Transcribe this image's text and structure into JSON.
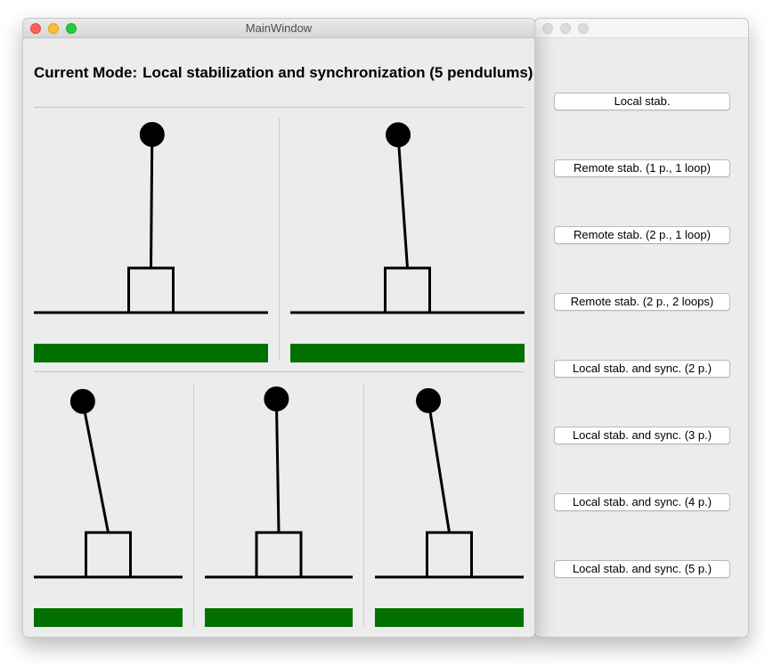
{
  "main_window": {
    "title": "MainWindow",
    "mode_prefix": "Current Mode:",
    "mode_value": "Local stabilization and synchronization (5 pendulums)"
  },
  "pendulums": [
    {
      "name": "pendulum-1",
      "angle_deg": 0.5,
      "status": "ok"
    },
    {
      "name": "pendulum-2",
      "angle_deg": -4,
      "status": "ok"
    },
    {
      "name": "pendulum-3",
      "angle_deg": -11,
      "status": "ok"
    },
    {
      "name": "pendulum-4",
      "angle_deg": -1,
      "status": "ok"
    },
    {
      "name": "pendulum-5",
      "angle_deg": -9,
      "status": "ok"
    }
  ],
  "side_window": {
    "title": "",
    "buttons": [
      "Local stab.",
      "Remote stab. (1 p., 1 loop)",
      "Remote stab. (2 p., 1 loop)",
      "Remote stab. (2 p., 2 loops)",
      "Local stab. and sync. (2 p.)",
      "Local stab. and sync. (3 p.)",
      "Local stab. and sync. (4 p.)",
      "Local stab. and sync. (5 p.)"
    ]
  },
  "colors": {
    "status_bar": "#007000",
    "pendulum_stroke": "#000000",
    "window_bg": "#ececec"
  }
}
